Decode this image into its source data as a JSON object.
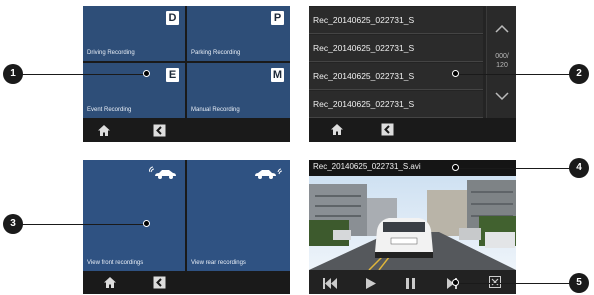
{
  "menu_screen": {
    "tiles": [
      {
        "letter": "D",
        "label": "Driving Recording"
      },
      {
        "letter": "P",
        "label": "Parking Recording"
      },
      {
        "letter": "E",
        "label": "Event Recording"
      },
      {
        "letter": "M",
        "label": "Manual Recording"
      }
    ]
  },
  "file_list_screen": {
    "files": [
      "Rec_20140625_022731_S",
      "Rec_20140625_022731_S",
      "Rec_20140625_022731_S",
      "Rec_20140625_022731_S"
    ],
    "page_indicator": "000/\n120"
  },
  "camera_screen": {
    "front_label": "View front recordings",
    "rear_label": "View rear recordings"
  },
  "player_screen": {
    "filename": "Rec_20140625_022731_S.avi"
  },
  "callouts": [
    "1",
    "2",
    "3",
    "4",
    "5"
  ],
  "colors": {
    "tile_blue": "#2e4e78",
    "nav_bg": "#1a1a1a"
  }
}
